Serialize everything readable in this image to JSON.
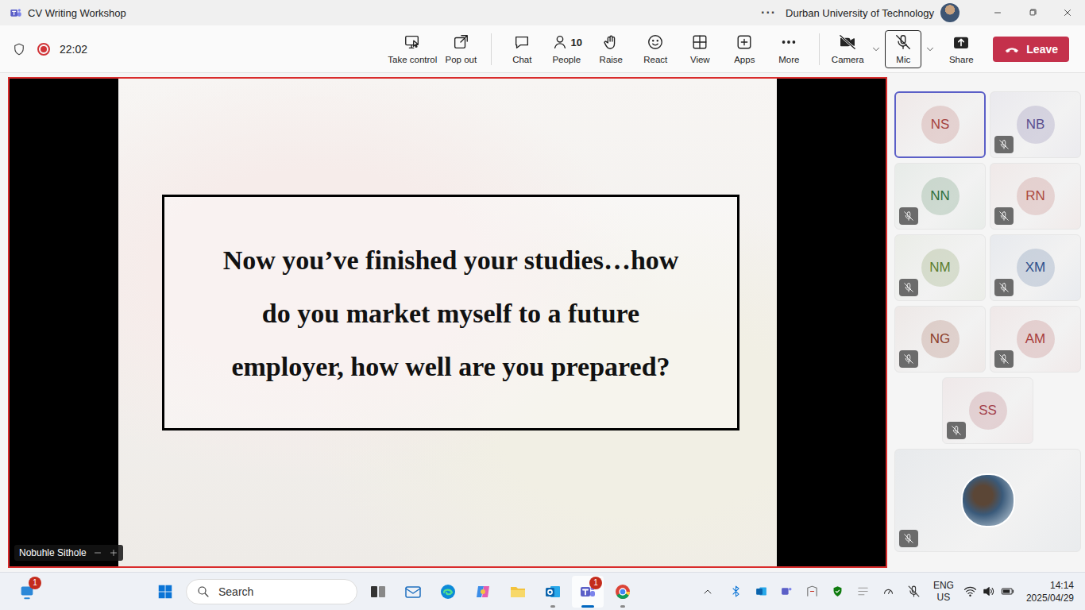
{
  "window": {
    "title": "CV Writing Workshop",
    "more": "···",
    "org": "Durban University of Technology"
  },
  "meeting_bar": {
    "timer": "22:02",
    "recording": true,
    "buttons": [
      {
        "label": "Take control",
        "selected": false,
        "dropdown": false
      },
      {
        "label": "Pop out",
        "selected": false,
        "dropdown": false
      },
      {
        "label": "Chat",
        "selected": false,
        "dropdown": false
      },
      {
        "label": "People",
        "count": "10",
        "selected": false,
        "dropdown": false
      },
      {
        "label": "Raise",
        "selected": false,
        "dropdown": false
      },
      {
        "label": "React",
        "selected": false,
        "dropdown": false
      },
      {
        "label": "View",
        "selected": false,
        "dropdown": false
      },
      {
        "label": "Apps",
        "selected": false,
        "dropdown": false
      },
      {
        "label": "More",
        "selected": false,
        "dropdown": false
      },
      {
        "label": "Camera",
        "off": true,
        "selected": false,
        "dropdown": true
      },
      {
        "label": "Mic",
        "muted": true,
        "selected": true,
        "dropdown": true
      },
      {
        "label": "Share",
        "selected": false,
        "dropdown": false
      }
    ],
    "leave": "Leave"
  },
  "stage": {
    "slide_lines": [
      "Now you’ve finished your studies…how",
      "do you market myself to a future",
      "employer, how well are you prepared?"
    ],
    "presenter": "Nobuhle Sithole"
  },
  "participants": [
    {
      "kind": "initials",
      "initials": "NS",
      "muted": false,
      "selected": true,
      "color": "#a5433f"
    },
    {
      "kind": "initials",
      "initials": "NB",
      "muted": true,
      "selected": false,
      "color": "#5a4f8f"
    },
    {
      "kind": "initials",
      "initials": "NN",
      "muted": true,
      "selected": false,
      "color": "#2f6e3c"
    },
    {
      "kind": "initials",
      "initials": "RN",
      "muted": true,
      "selected": false,
      "color": "#ad4a40"
    },
    {
      "kind": "initials",
      "initials": "NM",
      "muted": true,
      "selected": false,
      "color": "#5c7d2f"
    },
    {
      "kind": "initials",
      "initials": "XM",
      "muted": true,
      "selected": false,
      "color": "#2f518c"
    },
    {
      "kind": "initials",
      "initials": "NG",
      "muted": true,
      "selected": false,
      "color": "#8c3d28"
    },
    {
      "kind": "initials",
      "initials": "AM",
      "muted": true,
      "selected": false,
      "color": "#a83d3d"
    },
    {
      "kind": "initials",
      "initials": "SS",
      "muted": true,
      "selected": false,
      "color": "#a3424c"
    },
    {
      "kind": "photo",
      "muted": true,
      "selected": false,
      "color": "#3a5a7a"
    }
  ],
  "taskbar": {
    "notification_badge": "1",
    "search": "Search",
    "apps": [
      {
        "running": false,
        "selected": false
      },
      {
        "running": false,
        "selected": false
      },
      {
        "running": false,
        "selected": false
      },
      {
        "running": false,
        "selected": false
      },
      {
        "running": false,
        "selected": false
      },
      {
        "running": true,
        "selected": false
      },
      {
        "running": true,
        "selected": true,
        "badge": "1"
      },
      {
        "running": true,
        "selected": false
      }
    ]
  },
  "tray": {
    "lang": "ENG",
    "region": "US",
    "time": "14:14",
    "date": "2025/04/29",
    "mic_muted": true
  }
}
